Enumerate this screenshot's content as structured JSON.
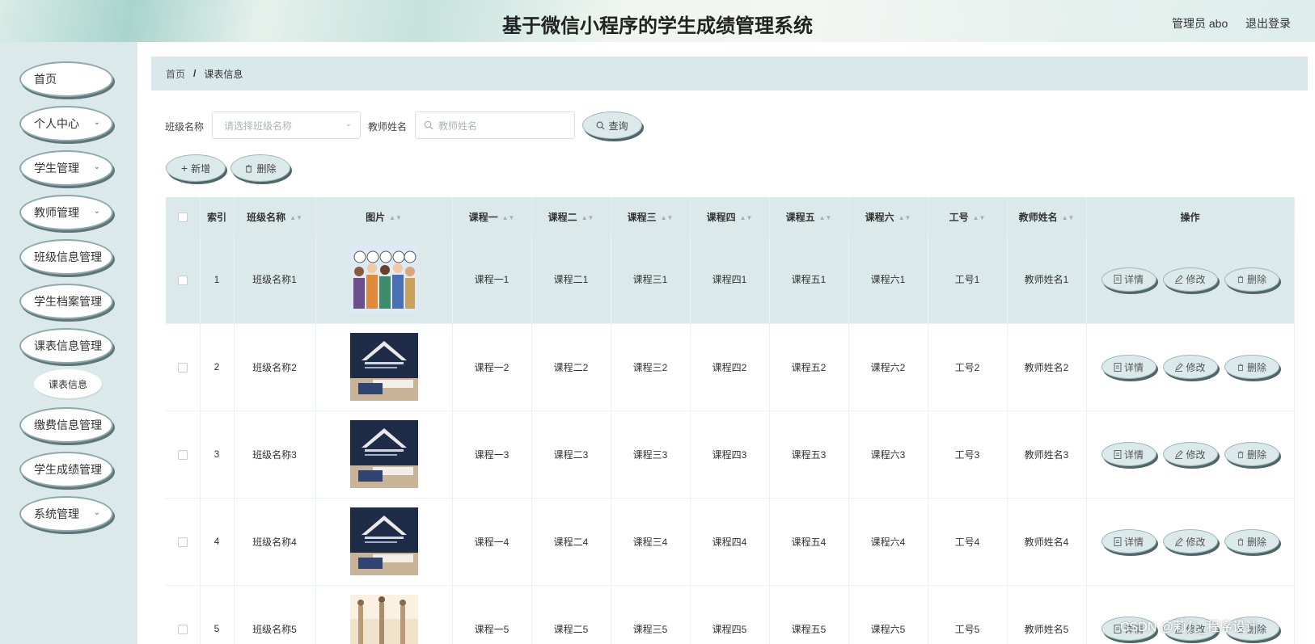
{
  "header": {
    "title": "基于微信小程序的学生成绩管理系统",
    "user": "管理员 abo",
    "logout": "退出登录"
  },
  "sidebar": {
    "items": [
      {
        "label": "首页",
        "has_children": false
      },
      {
        "label": "个人中心",
        "has_children": true
      },
      {
        "label": "学生管理",
        "has_children": true
      },
      {
        "label": "教师管理",
        "has_children": true
      },
      {
        "label": "班级信息管理",
        "has_children": false
      },
      {
        "label": "学生档案管理",
        "has_children": false
      },
      {
        "label": "课表信息管理",
        "has_children": false
      },
      {
        "label": "缴费信息管理",
        "has_children": false
      },
      {
        "label": "学生成绩管理",
        "has_children": false
      },
      {
        "label": "系统管理",
        "has_children": true
      }
    ],
    "active_sub": "课表信息"
  },
  "breadcrumb": {
    "home": "首页",
    "separator": "/",
    "current": "课表信息"
  },
  "search": {
    "class_label": "班级名称",
    "class_placeholder": "请选择班级名称",
    "teacher_label": "教师姓名",
    "teacher_placeholder": "教师姓名",
    "query_button": "查询"
  },
  "toolbar": {
    "add_button": "新增",
    "delete_button": "删除"
  },
  "table": {
    "columns": [
      "索引",
      "班级名称",
      "图片",
      "课程一",
      "课程二",
      "课程三",
      "课程四",
      "课程五",
      "课程六",
      "工号",
      "教师姓名",
      "操作"
    ],
    "actions": {
      "detail": "详情",
      "edit": "修改",
      "delete": "删除"
    },
    "rows": [
      {
        "index": "1",
        "class_name": "班级名称1",
        "image": "hello-kids",
        "c1": "课程一1",
        "c2": "课程二1",
        "c3": "课程三1",
        "c4": "课程四1",
        "c5": "课程五1",
        "c6": "课程六1",
        "job_no": "工号1",
        "teacher": "教师姓名1"
      },
      {
        "index": "2",
        "class_name": "班级名称2",
        "image": "study-book",
        "c1": "课程一2",
        "c2": "课程二2",
        "c3": "课程三2",
        "c4": "课程四2",
        "c5": "课程五2",
        "c6": "课程六2",
        "job_no": "工号2",
        "teacher": "教师姓名2"
      },
      {
        "index": "3",
        "class_name": "班级名称3",
        "image": "study-book",
        "c1": "课程一3",
        "c2": "课程二3",
        "c3": "课程三3",
        "c4": "课程四3",
        "c5": "课程五3",
        "c6": "课程六3",
        "job_no": "工号3",
        "teacher": "教师姓名3"
      },
      {
        "index": "4",
        "class_name": "班级名称4",
        "image": "study-book",
        "c1": "课程一4",
        "c2": "课程二4",
        "c3": "课程三4",
        "c4": "课程四4",
        "c5": "课程五4",
        "c6": "课程六4",
        "job_no": "工号4",
        "teacher": "教师姓名4"
      },
      {
        "index": "5",
        "class_name": "班级名称5",
        "image": "runners",
        "c1": "课程一5",
        "c2": "课程二5",
        "c3": "课程三5",
        "c4": "课程四5",
        "c5": "课程五5",
        "c6": "课程六5",
        "job_no": "工号5",
        "teacher": "教师姓名5"
      }
    ]
  },
  "watermark": "CSDN @莉儿_程序设计",
  "icons": {
    "search": "search-icon",
    "plus": "plus-icon",
    "trash": "trash-icon",
    "document": "document-icon",
    "edit": "edit-icon",
    "chevron": "chevron-down-icon"
  }
}
